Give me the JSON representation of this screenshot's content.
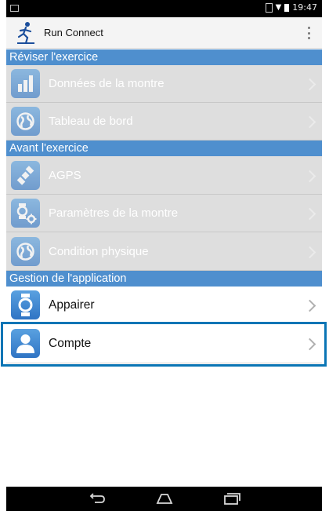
{
  "status_bar": {
    "time": "19:47"
  },
  "app_bar": {
    "title": "Run Connect",
    "logo_icon": "runner-logo-icon",
    "menu_icon": "overflow-menu-icon"
  },
  "sections": [
    {
      "title": "Réviser l'exercice",
      "items": [
        {
          "label": "Données de la montre",
          "icon": "bar-chart-icon",
          "enabled": false
        },
        {
          "label": "Tableau de bord",
          "icon": "globe-icon",
          "enabled": false
        }
      ]
    },
    {
      "title": "Avant l'exercice",
      "items": [
        {
          "label": "AGPS",
          "icon": "satellite-icon",
          "enabled": false
        },
        {
          "label": "Paramètres de la montre",
          "icon": "watch-settings-icon",
          "enabled": false
        },
        {
          "label": "Condition physique",
          "icon": "globe-icon",
          "enabled": false
        }
      ]
    },
    {
      "title": "Gestion de l'application",
      "items": [
        {
          "label": "Appairer",
          "icon": "watch-icon",
          "enabled": true
        },
        {
          "label": "Compte",
          "icon": "user-icon",
          "enabled": true,
          "highlighted": true
        }
      ]
    }
  ],
  "nav_bar": {
    "icons": [
      "back-icon",
      "home-icon",
      "recent-apps-icon"
    ]
  },
  "colors": {
    "section_header": "#4f8fce",
    "highlight_frame": "#0a75b5",
    "icon_tile": "#3a84d0",
    "disabled_row": "#dedede"
  }
}
